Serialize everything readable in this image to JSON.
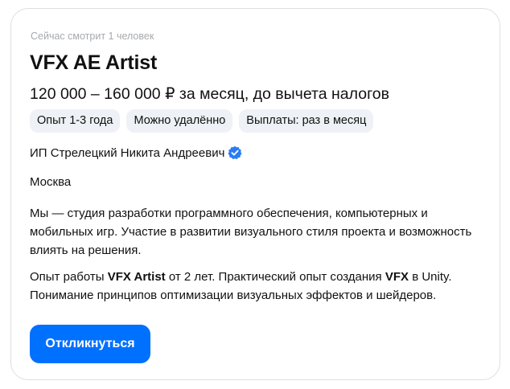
{
  "vacancy": {
    "viewers_text": "Сейчас смотрит 1 человек",
    "title": "VFX AE Artist",
    "salary": "120 000 – 160 000 ₽ за месяц, до вычета налогов",
    "tags": [
      "Опыт 1-3 года",
      "Можно удалённо",
      "Выплаты: раз в месяц"
    ],
    "employer": {
      "name": "ИП Стрелецкий Никита Андреевич",
      "verified_icon": "verified-check-icon",
      "verified_color": "#2b7bf5"
    },
    "city": "Москва",
    "description": "Мы — студия разработки программного обеспечения, компьютерных и мобильных игр. Участие в развитии визуального стиля проекта и возможность влиять на решения.",
    "requirements": {
      "part1": "Опыт работы ",
      "bold1": "VFX Artist",
      "part2": " от 2 лет. Практический опыт создания ",
      "bold2": "VFX",
      "part3": " в Unity. Понимание принципов оптимизации визуальных эффектов и шейдеров."
    },
    "apply_label": "Откликнуться",
    "accent_color": "#0070ff"
  }
}
